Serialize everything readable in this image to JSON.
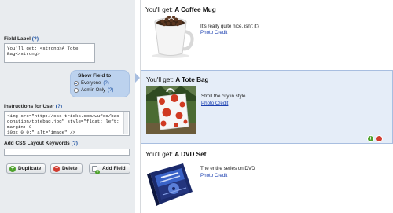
{
  "left_panel": {
    "field_label": {
      "label": "Field Label",
      "help": "(?)",
      "value": "You'll get: <strong>A Tote\nBag</strong>"
    },
    "show_field": {
      "title": "Show Field to",
      "options": [
        {
          "label": "Everyone",
          "help": "(?)",
          "selected": true
        },
        {
          "label": "Admin Only",
          "help": "(?)",
          "selected": false
        }
      ]
    },
    "instructions": {
      "label": "Instructions for User",
      "help": "(?)",
      "value": "<img src=\"http://css-tricks.com/wufoo/bas-\ndonation/totebag.jpg\" style=\"float: left; margin: 0\n10px 0 0;\" alt=\"image\" />\nStroll the city in style"
    },
    "css_keywords": {
      "label": "Add CSS Layout Keywords",
      "help": "(?)",
      "value": ""
    },
    "buttons": {
      "duplicate": "Duplicate",
      "delete": "Delete",
      "add_field": "Add Field"
    }
  },
  "items": [
    {
      "prefix": "You'll get: ",
      "name": "A Coffee Mug",
      "description": "It's really quite nice, isn't it?",
      "credit": "Photo Credit",
      "icon": "coffee-mug-image"
    },
    {
      "prefix": "You'll get: ",
      "name": "A Tote Bag",
      "description": "Stroll the city in style",
      "credit": "Photo Credit",
      "icon": "tote-bag-image"
    },
    {
      "prefix": "You'll get: ",
      "name": "A DVD Set",
      "description": "The entire series on DVD",
      "credit": "Photo Credit",
      "icon": "dvd-set-image"
    }
  ],
  "item_controls": {
    "add": "+",
    "remove": "−"
  },
  "colors": {
    "selected_bg": "#e5edf8",
    "selected_border": "#a8bee0",
    "show_field_bg": "#bcd2ee",
    "link": "#1a3fb0",
    "add_green": "#4ea22c",
    "delete_red": "#d13b2f"
  }
}
